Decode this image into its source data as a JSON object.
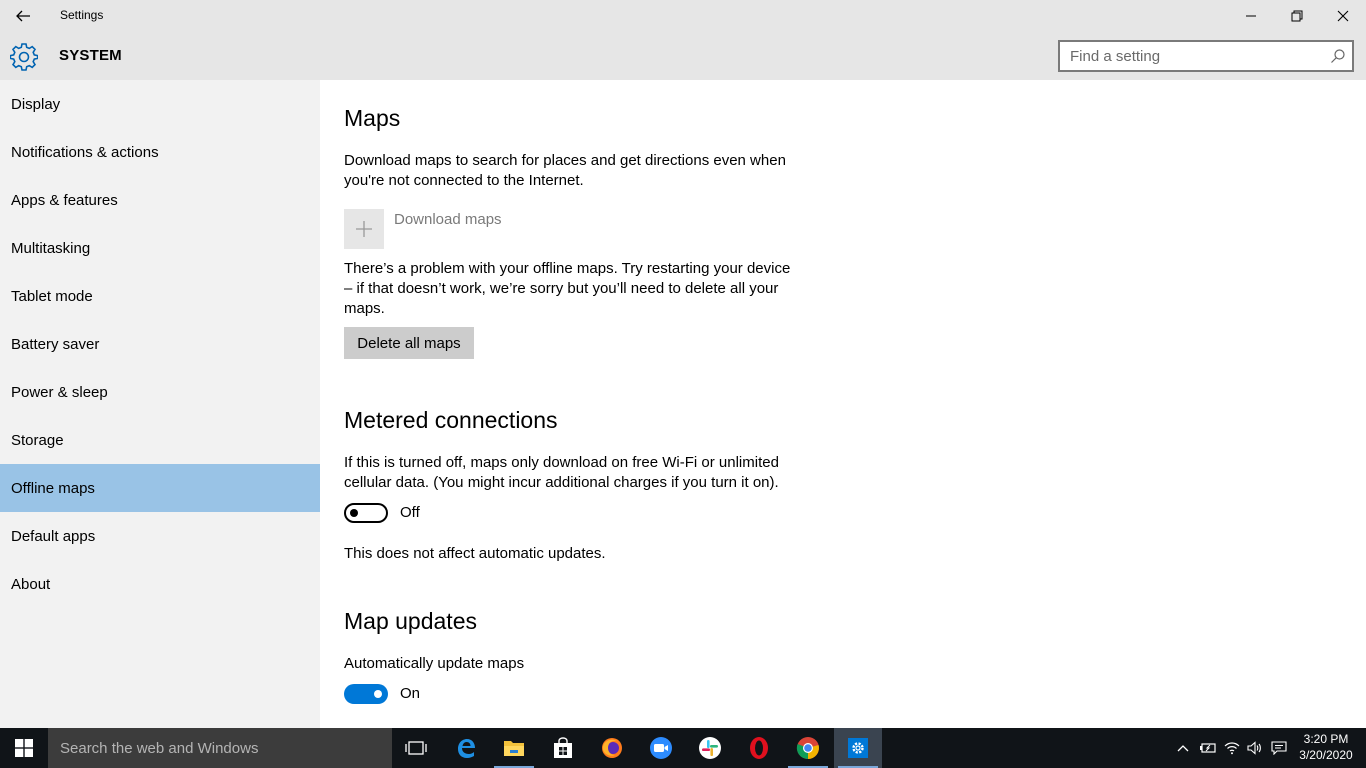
{
  "window": {
    "title": "Settings"
  },
  "header": {
    "section": "SYSTEM",
    "search_placeholder": "Find a setting"
  },
  "sidebar": {
    "items": [
      {
        "label": "Display"
      },
      {
        "label": "Notifications & actions"
      },
      {
        "label": "Apps & features"
      },
      {
        "label": "Multitasking"
      },
      {
        "label": "Tablet mode"
      },
      {
        "label": "Battery saver"
      },
      {
        "label": "Power & sleep"
      },
      {
        "label": "Storage"
      },
      {
        "label": "Offline maps",
        "selected": true
      },
      {
        "label": "Default apps"
      },
      {
        "label": "About"
      }
    ]
  },
  "main": {
    "maps": {
      "heading": "Maps",
      "description_line1": "Download maps to search for places and get directions even when",
      "description_line2": "you're not connected to the Internet.",
      "download_label": "Download maps",
      "problem_line1": "There’s a problem with your offline maps. Try restarting your device",
      "problem_line2": "– if that doesn’t work, we’re sorry but you’ll need to delete all your",
      "problem_line3": "maps.",
      "delete_button": "Delete all maps"
    },
    "metered": {
      "heading": "Metered connections",
      "description_line1": "If this is turned off, maps only download on free Wi-Fi or unlimited",
      "description_line2": "cellular data. (You might incur additional charges if you turn it on).",
      "toggle_state": "Off",
      "note": "This does not affect automatic updates."
    },
    "updates": {
      "heading": "Map updates",
      "auto_label": "Automatically update maps",
      "toggle_state": "On"
    }
  },
  "taskbar": {
    "search_placeholder": "Search the web and Windows",
    "apps": [
      "task-view",
      "edge",
      "file-explorer",
      "store",
      "firefox",
      "zoom",
      "slack",
      "opera",
      "chrome",
      "settings"
    ],
    "time": "3:20 PM",
    "date": "3/20/2020"
  },
  "colors": {
    "accent": "#0078d7",
    "selected_nav": "#99c3e6",
    "chrome_bg": "#e6e6e6",
    "sidebar_bg": "#f2f2f2",
    "taskbar_bg": "#101418"
  }
}
